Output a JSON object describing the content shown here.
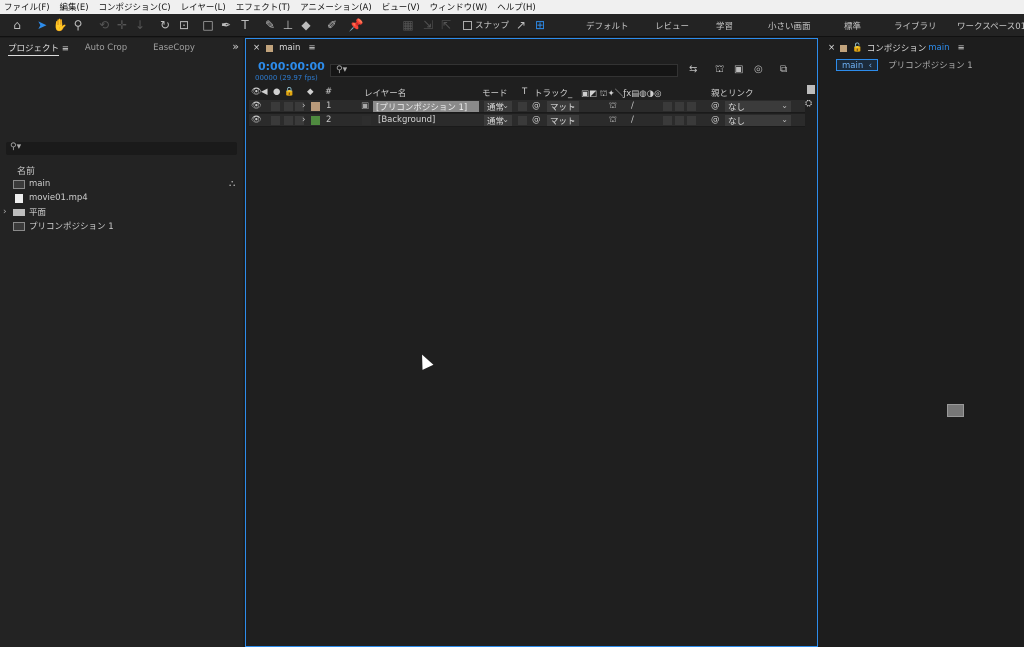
{
  "menu": [
    "ファイル(F)",
    "編集(E)",
    "コンポジション(C)",
    "レイヤー(L)",
    "エフェクト(T)",
    "アニメーション(A)",
    "ビュー(V)",
    "ウィンドウ(W)",
    "ヘルプ(H)"
  ],
  "toolbar": {
    "snap_label": "スナップ",
    "workspaces": [
      "デフォルト",
      "レビュー",
      "学習",
      "小さい画面",
      "標準",
      "ライブラリ",
      "ワークスペース01"
    ]
  },
  "project": {
    "tabs": [
      "プロジェクト",
      "Auto Crop",
      "EaseCopy"
    ],
    "column_name": "名前",
    "items": [
      {
        "label": "main",
        "type": "composition"
      },
      {
        "label": "movie01.mp4",
        "type": "file"
      },
      {
        "label": "平面",
        "type": "folder"
      },
      {
        "label": "プリコンポジション 1",
        "type": "composition"
      }
    ]
  },
  "timeline": {
    "tab_label": "main",
    "timecode": "0:00:00:00",
    "timecode_sub": "00000 (29.97 fps)",
    "headers": {
      "number": "#",
      "layer_name": "レイヤー名",
      "mode": "モード",
      "t": "T",
      "track": "トラック_",
      "parent": "親とリンク"
    },
    "layers": [
      {
        "index": "1",
        "name": "[プリコンポジション 1]",
        "mode": "通常",
        "matte": "マット",
        "parent": "なし",
        "label_color": "#b99a7a",
        "selected": true
      },
      {
        "index": "2",
        "name": "[Background]",
        "mode": "通常",
        "matte": "マット",
        "parent": "なし",
        "label_color": "#4f8a3f",
        "selected": false
      }
    ]
  },
  "comp": {
    "tab_prefix": "コンポジション",
    "tab_name": "main",
    "crumb_current": "main",
    "crumb_next": "プリコンポジション 1"
  },
  "colors": {
    "accent": "#2d8ceb"
  }
}
